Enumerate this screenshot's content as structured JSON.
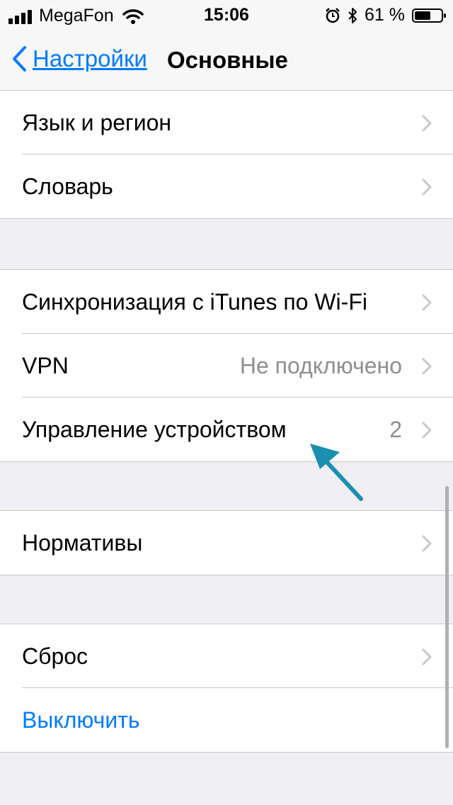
{
  "status": {
    "carrier": "MegaFon",
    "time": "15:06",
    "battery_percent": "61 %",
    "battery_level": 0.61
  },
  "nav": {
    "back_label": "Настройки",
    "title": "Основные"
  },
  "groups": [
    [
      {
        "title": "Язык и регион"
      },
      {
        "title": "Словарь"
      }
    ],
    [
      {
        "title": "Синхронизация с iTunes по Wi-Fi"
      },
      {
        "title": "VPN",
        "value": "Не подключено"
      },
      {
        "title": "Управление устройством",
        "value": "2"
      }
    ],
    [
      {
        "title": "Нормативы"
      }
    ],
    [
      {
        "title": "Сброс"
      },
      {
        "title": "Выключить"
      }
    ]
  ],
  "annotation": {
    "color": "#1a8fb0",
    "icon": "arrow-icon"
  },
  "colors": {
    "accent": "#007aff",
    "secondary_text": "#8e8e93",
    "background": "#efeff4"
  }
}
